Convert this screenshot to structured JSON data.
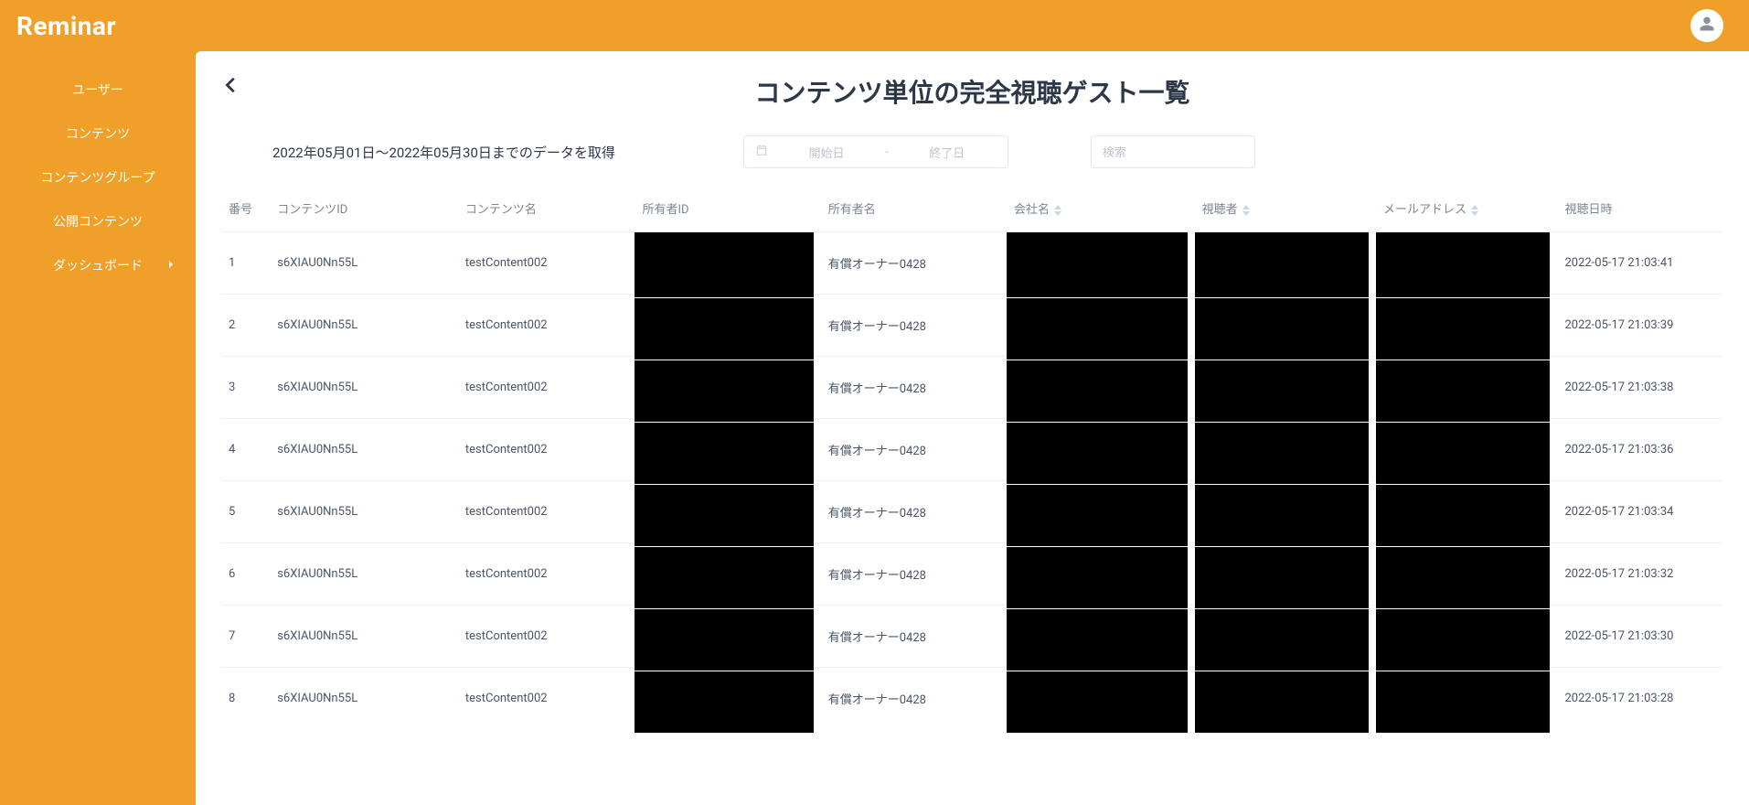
{
  "brand": "Reminar",
  "sidebar": {
    "items": [
      {
        "label": "ユーザー"
      },
      {
        "label": "コンテンツ"
      },
      {
        "label": "コンテンツグループ"
      },
      {
        "label": "公開コンテンツ"
      },
      {
        "label": "ダッシュボード",
        "expandable": true
      }
    ]
  },
  "page": {
    "title": "コンテンツ単位の完全視聴ゲスト一覧",
    "date_summary": "2022年05月01日～2022年05月30日までのデータを取得",
    "date_start_placeholder": "開始日",
    "date_end_placeholder": "終了日",
    "date_separator": "-",
    "search_placeholder": "検索"
  },
  "table": {
    "headers": {
      "num": "番号",
      "content_id": "コンテンツID",
      "content_name": "コンテンツ名",
      "owner_id": "所有者ID",
      "owner_name": "所有者名",
      "company": "会社名",
      "viewer": "視聴者",
      "email": "メールアドレス",
      "view_datetime": "視聴日時"
    },
    "rows": [
      {
        "num": "1",
        "content_id": "s6XIAU0Nn55L",
        "content_name": "testContent002",
        "owner_id": "",
        "owner_name": "有償オーナー0428",
        "company": "",
        "viewer": "",
        "email": "",
        "view_datetime": "2022-05-17 21:03:41"
      },
      {
        "num": "2",
        "content_id": "s6XIAU0Nn55L",
        "content_name": "testContent002",
        "owner_id": "",
        "owner_name": "有償オーナー0428",
        "company": "",
        "viewer": "",
        "email": "",
        "view_datetime": "2022-05-17 21:03:39"
      },
      {
        "num": "3",
        "content_id": "s6XIAU0Nn55L",
        "content_name": "testContent002",
        "owner_id": "",
        "owner_name": "有償オーナー0428",
        "company": "",
        "viewer": "",
        "email": "",
        "view_datetime": "2022-05-17 21:03:38"
      },
      {
        "num": "4",
        "content_id": "s6XIAU0Nn55L",
        "content_name": "testContent002",
        "owner_id": "",
        "owner_name": "有償オーナー0428",
        "company": "",
        "viewer": "",
        "email": "",
        "view_datetime": "2022-05-17 21:03:36"
      },
      {
        "num": "5",
        "content_id": "s6XIAU0Nn55L",
        "content_name": "testContent002",
        "owner_id": "",
        "owner_name": "有償オーナー0428",
        "company": "",
        "viewer": "",
        "email": "",
        "view_datetime": "2022-05-17 21:03:34"
      },
      {
        "num": "6",
        "content_id": "s6XIAU0Nn55L",
        "content_name": "testContent002",
        "owner_id": "",
        "owner_name": "有償オーナー0428",
        "company": "",
        "viewer": "",
        "email": "",
        "view_datetime": "2022-05-17 21:03:32"
      },
      {
        "num": "7",
        "content_id": "s6XIAU0Nn55L",
        "content_name": "testContent002",
        "owner_id": "",
        "owner_name": "有償オーナー0428",
        "company": "",
        "viewer": "",
        "email": "",
        "view_datetime": "2022-05-17 21:03:30"
      },
      {
        "num": "8",
        "content_id": "s6XIAU0Nn55L",
        "content_name": "testContent002",
        "owner_id": "",
        "owner_name": "有償オーナー0428",
        "company": "",
        "viewer": "",
        "email": "",
        "view_datetime": "2022-05-17 21:03:28"
      }
    ],
    "redacted_columns": [
      "owner_id",
      "company",
      "viewer",
      "email"
    ]
  }
}
